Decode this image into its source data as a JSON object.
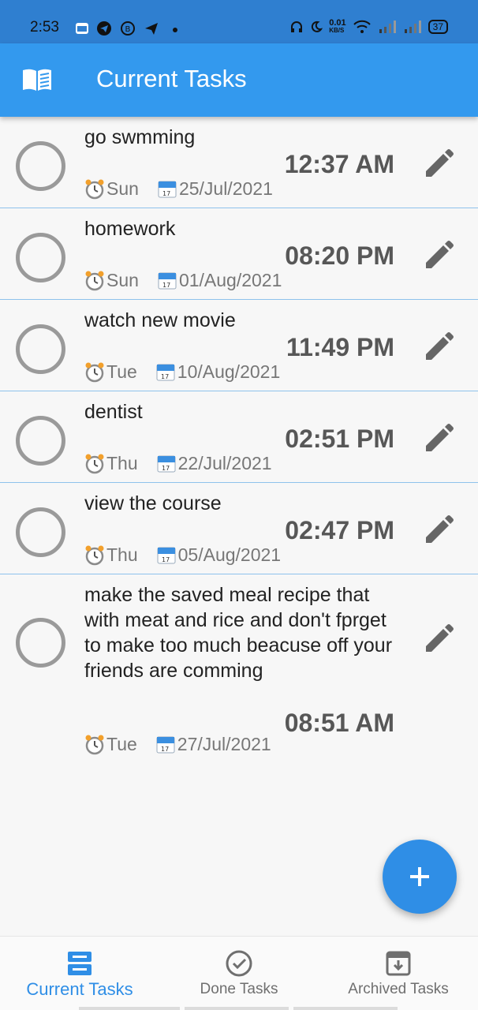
{
  "status_bar": {
    "time": "2:53",
    "net_speed_value": "0.01",
    "net_speed_unit": "KB/S",
    "battery": "37"
  },
  "app_bar": {
    "title": "Current Tasks",
    "icon": "book-icon"
  },
  "tasks": [
    {
      "title": "go swmming",
      "time": "12:37 AM",
      "day": "Sun",
      "date": "25/Jul/2021"
    },
    {
      "title": "homework",
      "time": "08:20 PM",
      "day": "Sun",
      "date": "01/Aug/2021"
    },
    {
      "title": "watch new movie",
      "time": "11:49 PM",
      "day": "Tue",
      "date": "10/Aug/2021"
    },
    {
      "title": "dentist",
      "time": "02:51 PM",
      "day": "Thu",
      "date": "22/Jul/2021"
    },
    {
      "title": "view the course",
      "time": "02:47 PM",
      "day": "Thu",
      "date": "05/Aug/2021"
    },
    {
      "title": "make the saved meal recipe that with meat and rice and don't fprget to make too much beacuse off your friends are comming",
      "time": "08:51 AM",
      "day": "Tue",
      "date": "27/Jul/2021"
    }
  ],
  "fab": {
    "icon": "plus-icon"
  },
  "bottom_nav": {
    "active_color": "#2f8ee6",
    "items": [
      {
        "label": "Current Tasks",
        "icon": "inbox-tray-icon"
      },
      {
        "label": "Done Tasks",
        "icon": "check-circle-icon"
      },
      {
        "label": "Archived Tasks",
        "icon": "archive-icon"
      }
    ]
  },
  "colors": {
    "app_bar": "#3399ee",
    "status_bar": "#2f7fd0",
    "divider": "#8ec2ec",
    "time_text": "#575757"
  }
}
